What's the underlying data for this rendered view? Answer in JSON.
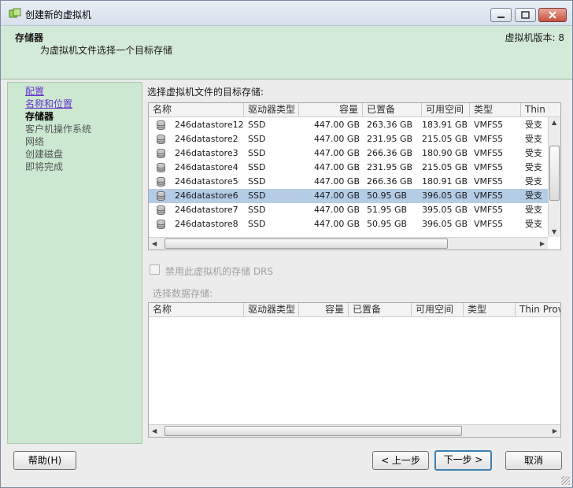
{
  "window": {
    "title": "创建新的虚拟机"
  },
  "header": {
    "title": "存储器",
    "subtitle": "为虚拟机文件选择一个目标存储",
    "version": "虚拟机版本: 8"
  },
  "nav": {
    "items": [
      {
        "label": "配置",
        "state": "link"
      },
      {
        "label": "名称和位置",
        "state": "link"
      },
      {
        "label": "存储器",
        "state": "current"
      },
      {
        "label": "客户机操作系统",
        "state": "pending"
      },
      {
        "label": "网络",
        "state": "pending"
      },
      {
        "label": "创建磁盘",
        "state": "pending"
      },
      {
        "label": "即将完成",
        "state": "pending"
      }
    ]
  },
  "target": {
    "label": "选择虚拟机文件的目标存储:",
    "columns": [
      "名称",
      "驱动器类型",
      "容量",
      "已置备",
      "可用空间",
      "类型",
      "Thin Pro"
    ],
    "rows": [
      {
        "name": "246datastore12",
        "drive": "SSD",
        "capacity": "447.00 GB",
        "provisioned": "263.36 GB",
        "free": "183.91 GB",
        "type": "VMFS5",
        "thin": "受支"
      },
      {
        "name": "246datastore2",
        "drive": "SSD",
        "capacity": "447.00 GB",
        "provisioned": "231.95 GB",
        "free": "215.05 GB",
        "type": "VMFS5",
        "thin": "受支"
      },
      {
        "name": "246datastore3",
        "drive": "SSD",
        "capacity": "447.00 GB",
        "provisioned": "266.36 GB",
        "free": "180.90 GB",
        "type": "VMFS5",
        "thin": "受支"
      },
      {
        "name": "246datastore4",
        "drive": "SSD",
        "capacity": "447.00 GB",
        "provisioned": "231.95 GB",
        "free": "215.05 GB",
        "type": "VMFS5",
        "thin": "受支"
      },
      {
        "name": "246datastore5",
        "drive": "SSD",
        "capacity": "447.00 GB",
        "provisioned": "266.36 GB",
        "free": "180.91 GB",
        "type": "VMFS5",
        "thin": "受支"
      },
      {
        "name": "246datastore6",
        "drive": "SSD",
        "capacity": "447.00 GB",
        "provisioned": "50.95 GB",
        "free": "396.05 GB",
        "type": "VMFS5",
        "thin": "受支",
        "selected": true
      },
      {
        "name": "246datastore7",
        "drive": "SSD",
        "capacity": "447.00 GB",
        "provisioned": "51.95 GB",
        "free": "395.05 GB",
        "type": "VMFS5",
        "thin": "受支"
      },
      {
        "name": "246datastore8",
        "drive": "SSD",
        "capacity": "447.00 GB",
        "provisioned": "50.95 GB",
        "free": "396.05 GB",
        "type": "VMFS5",
        "thin": "受支"
      }
    ]
  },
  "drs": {
    "label": "禁用此虚拟机的存储 DRS",
    "checked": false
  },
  "select": {
    "label": "选择数据存储:",
    "columns": [
      "名称",
      "驱动器类型",
      "容量",
      "已置备",
      "可用空间",
      "类型",
      "Thin Provi"
    ]
  },
  "buttons": {
    "help": "帮助(H)",
    "back": "< 上一步",
    "next": "下一步 >",
    "cancel": "取消"
  },
  "icons": {
    "app": "vm-app-icon",
    "datastore": "datastore-icon"
  }
}
